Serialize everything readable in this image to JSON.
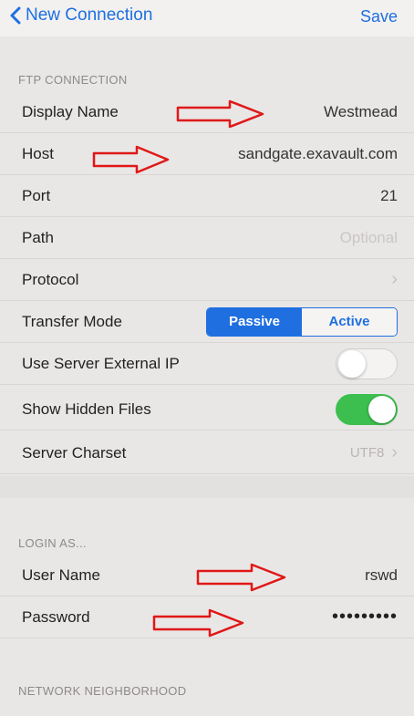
{
  "nav": {
    "back_label": "New Connection",
    "save_label": "Save"
  },
  "ftp_section": {
    "header": "FTP CONNECTION",
    "rows": {
      "display_name": {
        "label": "Display Name",
        "value": "Westmead"
      },
      "host": {
        "label": "Host",
        "value": "sandgate.exavault.com"
      },
      "port": {
        "label": "Port",
        "value": "21"
      },
      "path": {
        "label": "Path",
        "placeholder": "Optional"
      },
      "protocol": {
        "label": "Protocol"
      },
      "transfer_mode": {
        "label": "Transfer Mode",
        "options": [
          "Passive",
          "Active"
        ],
        "selected": "Passive"
      },
      "use_server_external_ip": {
        "label": "Use Server External IP",
        "enabled": false
      },
      "show_hidden_files": {
        "label": "Show Hidden Files",
        "enabled": true
      },
      "server_charset": {
        "label": "Server Charset",
        "value": "UTF8"
      }
    }
  },
  "login_section": {
    "header": "LOGIN AS...",
    "rows": {
      "user_name": {
        "label": "User Name",
        "value": "rswd"
      },
      "password": {
        "label": "Password",
        "value": "•••••••••"
      }
    }
  },
  "network_section": {
    "header": "NETWORK NEIGHBORHOOD"
  },
  "colors": {
    "accent": "#1f6fe0",
    "toggle_on": "#3cbf4e",
    "annotation_arrow": "#e01818"
  },
  "icons": {
    "back": "chevron-left-icon",
    "disclosure": "chevron-right-icon",
    "annotation": "arrow-right-icon"
  }
}
